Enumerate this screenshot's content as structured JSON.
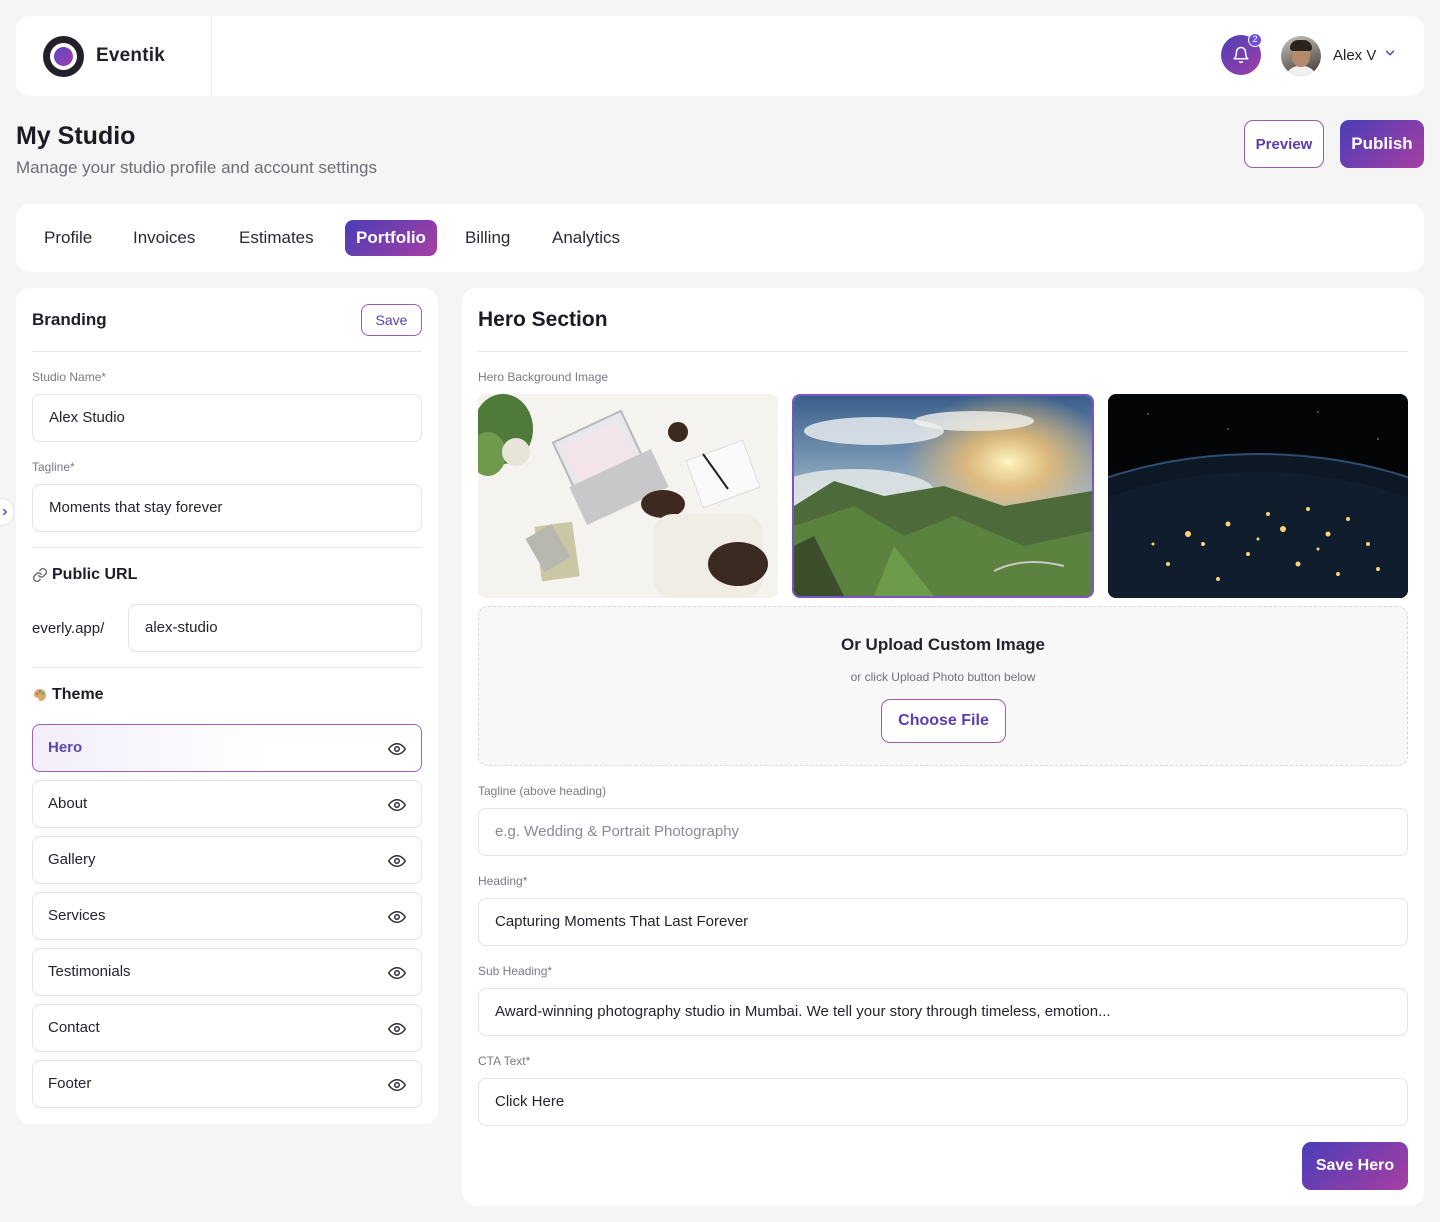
{
  "brand": {
    "name": "Eventik"
  },
  "header": {
    "notification_count": "2",
    "user_name": "Alex V"
  },
  "page": {
    "title": "My Studio",
    "subtitle": "Manage your studio profile and account settings",
    "preview_label": "Preview",
    "publish_label": "Publish"
  },
  "tabs": [
    {
      "label": "Profile",
      "active": false
    },
    {
      "label": "Invoices",
      "active": false
    },
    {
      "label": "Estimates",
      "active": false
    },
    {
      "label": "Portfolio",
      "active": true
    },
    {
      "label": "Billing",
      "active": false
    },
    {
      "label": "Analytics",
      "active": false
    }
  ],
  "branding": {
    "title": "Branding",
    "save_label": "Save",
    "studio_name_label": "Studio Name*",
    "studio_name_value": "Alex Studio",
    "tagline_label": "Tagline*",
    "tagline_value": "Moments that stay forever",
    "public_url_title": "Public URL",
    "url_prefix": "everly.app/",
    "url_slug": "alex-studio",
    "theme_title": "Theme",
    "theme_items": [
      {
        "label": "Hero",
        "active": true,
        "icon": "eye-icon"
      },
      {
        "label": "About",
        "active": false,
        "icon": "eye-icon"
      },
      {
        "label": "Gallery",
        "active": false,
        "icon": "eye-icon"
      },
      {
        "label": "Services",
        "active": false,
        "icon": "eye-icon"
      },
      {
        "label": "Testimonials",
        "active": false,
        "icon": "eye-icon"
      },
      {
        "label": "Contact",
        "active": false,
        "icon": "eye-icon"
      },
      {
        "label": "Footer",
        "active": false,
        "icon": "eye-icon"
      }
    ]
  },
  "hero": {
    "title": "Hero Section",
    "bg_image_label": "Hero Background Image",
    "images": [
      {
        "name": "laptop-workspace-image",
        "selected": false
      },
      {
        "name": "mountain-sunset-image",
        "selected": true
      },
      {
        "name": "earth-night-image",
        "selected": false
      }
    ],
    "upload_title": "Or Upload Custom Image",
    "upload_sub": "or click Upload Photo button below",
    "choose_file_label": "Choose File",
    "tagline_label": "Tagline (above heading)",
    "tagline_placeholder": "e.g. Wedding & Portrait Photography",
    "heading_label": "Heading*",
    "heading_value": "Capturing Moments That Last Forever",
    "subheading_label": "Sub Heading*",
    "subheading_value": "Award-winning photography studio in Mumbai. We tell your story through timeless, emotion...",
    "cta_label": "CTA Text*",
    "cta_value": "Click Here",
    "save_label": "Save Hero"
  },
  "colors": {
    "accent_start": "#4a3eb8",
    "accent_end": "#a73ea2",
    "page_bg": "#f5f5f6"
  }
}
